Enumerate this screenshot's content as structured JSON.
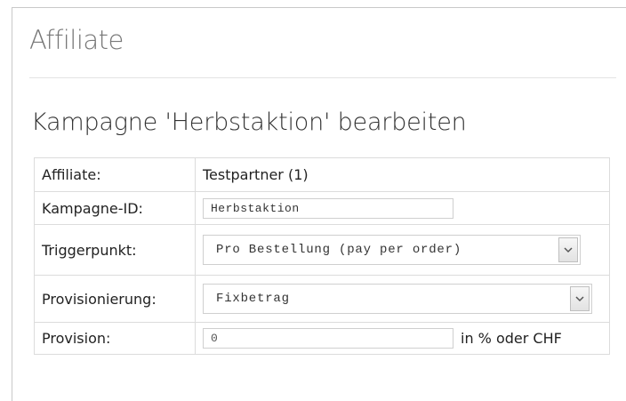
{
  "page": {
    "title": "Affiliate",
    "section_title": "Kampagne 'Herbstaktion' bearbeiten"
  },
  "form": {
    "affiliate": {
      "label": "Affiliate:",
      "value": "Testpartner (1)"
    },
    "campaign_id": {
      "label": "Kampagne-ID:",
      "value": "Herbstaktion"
    },
    "trigger": {
      "label": "Triggerpunkt:",
      "selected": "Pro Bestellung (pay per order)",
      "icon": "chevron-down-icon"
    },
    "commission_type": {
      "label": "Provisionierung:",
      "selected": "Fixbetrag",
      "icon": "chevron-down-icon"
    },
    "commission": {
      "label": "Provision:",
      "value": "0",
      "unit": "in % oder CHF"
    }
  }
}
